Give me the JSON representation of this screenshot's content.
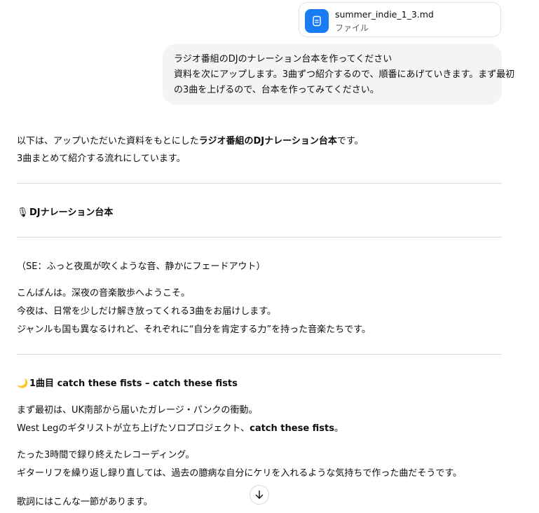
{
  "attachment": {
    "filename": "summer_indie_1_3.md",
    "type": "ファイル",
    "icon": "document-icon",
    "icon_color": "#1a7cf5"
  },
  "user_message": {
    "lines": [
      "ラジオ番組のDJのナレーション台本を作ってください",
      "資料を次にアップします。3曲ずつ紹介するので、順番にあげていきます。まず最初",
      "の3曲を上げるので、台本を作ってみてください。"
    ]
  },
  "assistant": {
    "intro_1_pre": "以下は、アップいただいた資料をもとにした",
    "intro_1_bold": "ラジオ番組のDJナレーション台本",
    "intro_1_post": "です。",
    "intro_2": "3曲まとめて紹介する流れにしています。",
    "section_icon": "🎙",
    "section_title": "DJナレーション台本",
    "se_line": "（SE：ふっと夜風が吹くような音、静かにフェードアウト）",
    "opening": [
      "こんばんは。深夜の音楽散歩へようこそ。",
      "今夜は、日常を少しだけ解き放ってくれる3曲をお届けします。",
      "ジャンルも国も異なるけれど、それぞれに“自分を肯定する力”を持った音楽たちです。"
    ],
    "track1_icon": "🌙",
    "track1_title": "1曲目 catch these fists – catch these fists",
    "track1_p1": "まず最初は、UK南部から届いたガレージ・パンクの衝動。",
    "track1_p2_pre": "West Legのギタリストが立ち上げたソロプロジェクト、",
    "track1_p2_bold": "catch these fists",
    "track1_p2_post": "。",
    "track1_p3": "たった3時間で録り終えたレコーディング。",
    "track1_p4": "ギターリフを繰り返し録り直しては、過去の臆病な自分にケリを入れるような気持ちで作った曲だそうです。",
    "track1_p5": "歌詞にはこんな一節があります。"
  },
  "scroll_button": {
    "icon": "arrow-down-icon"
  }
}
